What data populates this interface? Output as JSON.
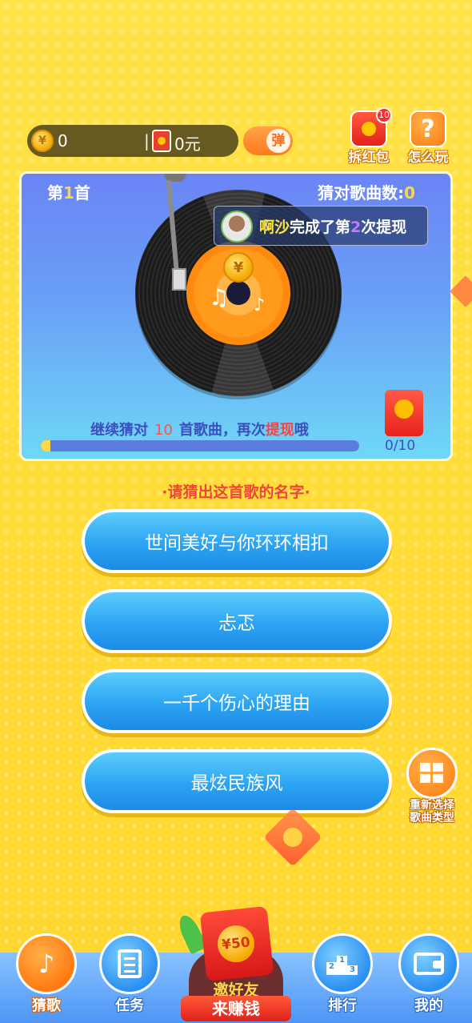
{
  "topbar": {
    "coins": "0",
    "separator": "|",
    "cash": "0元",
    "danmu_label": "弹"
  },
  "top_icons": {
    "redpack_badge": "10",
    "redpack_label": "拆红包",
    "help_symbol": "?",
    "help_label": "怎么玩"
  },
  "player": {
    "song_prefix": "第",
    "song_num": "1",
    "song_suffix": "首",
    "correct_label": "猜对歌曲数:",
    "correct_count": "0",
    "coin_symbol": "¥",
    "toast": {
      "name": "啊沙",
      "text1": "完成了第",
      "num": "2",
      "text2": "次提现"
    },
    "hint": {
      "pre": "继续猜对",
      "num": "10",
      "mid": "首歌曲，再次",
      "red": "提现",
      "post": "哦"
    },
    "progress_text": "0/10",
    "progress_fraction": 0.03
  },
  "prompt": "·请猜出这首歌的名字·",
  "options": [
    "世间美好与你环环相扣",
    "忐忑",
    "一千个伤心的理由",
    "最炫民族风"
  ],
  "side_button": {
    "line1": "重新选择",
    "line2": "歌曲类型"
  },
  "invite": {
    "amount": "¥50",
    "line1": "邀好友",
    "line2": "来赚钱"
  },
  "nav": {
    "guess": "猜歌",
    "tasks": "任务",
    "rank": "排行",
    "mine": "我的"
  }
}
